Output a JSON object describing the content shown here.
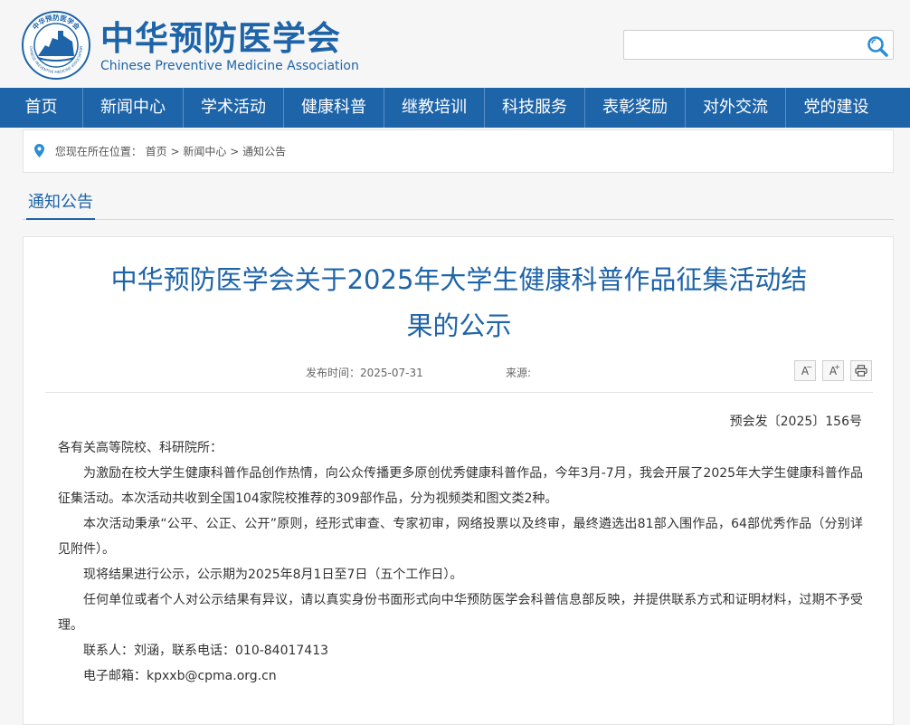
{
  "header": {
    "logo_cn": "中华预防医学会",
    "logo_en": "Chinese Preventive Medicine Association",
    "emblem_text": "中华预防医学会",
    "emblem_text_en": "CHINESE PREVENTIVE MEDICINE ASSOCIATION",
    "search_placeholder": "",
    "brand_color": "#1e64a8"
  },
  "nav": {
    "items": [
      {
        "label": "首页"
      },
      {
        "label": "新闻中心"
      },
      {
        "label": "学术活动"
      },
      {
        "label": "健康科普"
      },
      {
        "label": "继教培训"
      },
      {
        "label": "科技服务"
      },
      {
        "label": "表彰奖励"
      },
      {
        "label": "对外交流"
      },
      {
        "label": "党的建设"
      }
    ]
  },
  "breadcrumb": {
    "prefix": "您现在所在位置：",
    "items": [
      "首页",
      "新闻中心",
      "通知公告"
    ],
    "separator": ">"
  },
  "section_tab": "通知公告",
  "article": {
    "title_line1": "中华预防医学会关于2025年大学生健康科普作品征集活动结",
    "title_line2": "果的公示",
    "publish_label": "发布时间：",
    "publish_date": "2025-07-31",
    "source_label": "来源:",
    "tools": {
      "font_smaller": "A",
      "font_larger": "A",
      "print_icon": "printer-icon"
    },
    "doc_number": "预会发〔2025〕156号",
    "salutation": "各有关高等院校、科研院所：",
    "paragraphs": [
      "为激励在校大学生健康科普作品创作热情，向公众传播更多原创优秀健康科普作品，今年3月-7月，我会开展了2025年大学生健康科普作品征集活动。本次活动共收到全国104家院校推荐的309部作品，分为视频类和图文类2种。",
      "本次活动秉承“公平、公正、公开”原则，经形式审查、专家初审，网络投票以及终审，最终遴选出81部入围作品，64部优秀作品（分别详见附件）。",
      "现将结果进行公示，公示期为2025年8月1日至7日（五个工作日）。",
      "任何单位或者个人对公示结果有异议，请以真实身份书面形式向中华预防医学会科普信息部反映，并提供联系方式和证明材料，过期不予受理。",
      "联系人：刘涵，联系电话：010-84017413",
      "电子邮箱：kpxxb@cpma.org.cn"
    ]
  }
}
